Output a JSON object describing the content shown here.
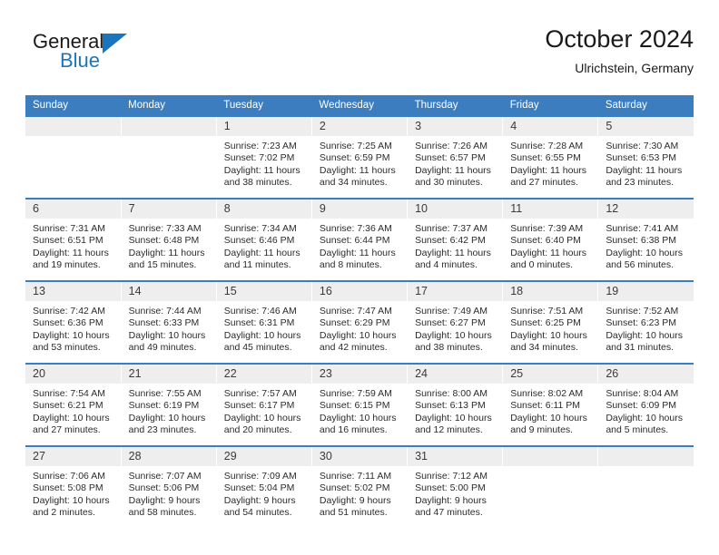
{
  "logo": {
    "word_one": "General",
    "word_two": "Blue",
    "mark": "triangle-mark",
    "color_dark": "#1a1a1a",
    "color_blue": "#1b75bc"
  },
  "header": {
    "title": "October 2024",
    "subtitle": "Ulrichstein, Germany"
  },
  "theme": {
    "header_blue": "#3c7dc0",
    "daynum_band": "#eeeeee",
    "text": "#2b2b2b"
  },
  "weekdays": [
    "Sunday",
    "Monday",
    "Tuesday",
    "Wednesday",
    "Thursday",
    "Friday",
    "Saturday"
  ],
  "labels": {
    "sunrise_prefix": "Sunrise: ",
    "sunset_prefix": "Sunset: ",
    "daylight_prefix": "Daylight: "
  },
  "weeks": [
    [
      {
        "blank": true,
        "day": "",
        "sunrise": "",
        "sunset": "",
        "daylight_line1": "",
        "daylight_line2": ""
      },
      {
        "blank": true,
        "day": "",
        "sunrise": "",
        "sunset": "",
        "daylight_line1": "",
        "daylight_line2": ""
      },
      {
        "blank": false,
        "day": "1",
        "sunrise": "Sunrise: 7:23 AM",
        "sunset": "Sunset: 7:02 PM",
        "daylight_line1": "Daylight: 11 hours",
        "daylight_line2": "and 38 minutes."
      },
      {
        "blank": false,
        "day": "2",
        "sunrise": "Sunrise: 7:25 AM",
        "sunset": "Sunset: 6:59 PM",
        "daylight_line1": "Daylight: 11 hours",
        "daylight_line2": "and 34 minutes."
      },
      {
        "blank": false,
        "day": "3",
        "sunrise": "Sunrise: 7:26 AM",
        "sunset": "Sunset: 6:57 PM",
        "daylight_line1": "Daylight: 11 hours",
        "daylight_line2": "and 30 minutes."
      },
      {
        "blank": false,
        "day": "4",
        "sunrise": "Sunrise: 7:28 AM",
        "sunset": "Sunset: 6:55 PM",
        "daylight_line1": "Daylight: 11 hours",
        "daylight_line2": "and 27 minutes."
      },
      {
        "blank": false,
        "day": "5",
        "sunrise": "Sunrise: 7:30 AM",
        "sunset": "Sunset: 6:53 PM",
        "daylight_line1": "Daylight: 11 hours",
        "daylight_line2": "and 23 minutes."
      }
    ],
    [
      {
        "blank": false,
        "day": "6",
        "sunrise": "Sunrise: 7:31 AM",
        "sunset": "Sunset: 6:51 PM",
        "daylight_line1": "Daylight: 11 hours",
        "daylight_line2": "and 19 minutes."
      },
      {
        "blank": false,
        "day": "7",
        "sunrise": "Sunrise: 7:33 AM",
        "sunset": "Sunset: 6:48 PM",
        "daylight_line1": "Daylight: 11 hours",
        "daylight_line2": "and 15 minutes."
      },
      {
        "blank": false,
        "day": "8",
        "sunrise": "Sunrise: 7:34 AM",
        "sunset": "Sunset: 6:46 PM",
        "daylight_line1": "Daylight: 11 hours",
        "daylight_line2": "and 11 minutes."
      },
      {
        "blank": false,
        "day": "9",
        "sunrise": "Sunrise: 7:36 AM",
        "sunset": "Sunset: 6:44 PM",
        "daylight_line1": "Daylight: 11 hours",
        "daylight_line2": "and 8 minutes."
      },
      {
        "blank": false,
        "day": "10",
        "sunrise": "Sunrise: 7:37 AM",
        "sunset": "Sunset: 6:42 PM",
        "daylight_line1": "Daylight: 11 hours",
        "daylight_line2": "and 4 minutes."
      },
      {
        "blank": false,
        "day": "11",
        "sunrise": "Sunrise: 7:39 AM",
        "sunset": "Sunset: 6:40 PM",
        "daylight_line1": "Daylight: 11 hours",
        "daylight_line2": "and 0 minutes."
      },
      {
        "blank": false,
        "day": "12",
        "sunrise": "Sunrise: 7:41 AM",
        "sunset": "Sunset: 6:38 PM",
        "daylight_line1": "Daylight: 10 hours",
        "daylight_line2": "and 56 minutes."
      }
    ],
    [
      {
        "blank": false,
        "day": "13",
        "sunrise": "Sunrise: 7:42 AM",
        "sunset": "Sunset: 6:36 PM",
        "daylight_line1": "Daylight: 10 hours",
        "daylight_line2": "and 53 minutes."
      },
      {
        "blank": false,
        "day": "14",
        "sunrise": "Sunrise: 7:44 AM",
        "sunset": "Sunset: 6:33 PM",
        "daylight_line1": "Daylight: 10 hours",
        "daylight_line2": "and 49 minutes."
      },
      {
        "blank": false,
        "day": "15",
        "sunrise": "Sunrise: 7:46 AM",
        "sunset": "Sunset: 6:31 PM",
        "daylight_line1": "Daylight: 10 hours",
        "daylight_line2": "and 45 minutes."
      },
      {
        "blank": false,
        "day": "16",
        "sunrise": "Sunrise: 7:47 AM",
        "sunset": "Sunset: 6:29 PM",
        "daylight_line1": "Daylight: 10 hours",
        "daylight_line2": "and 42 minutes."
      },
      {
        "blank": false,
        "day": "17",
        "sunrise": "Sunrise: 7:49 AM",
        "sunset": "Sunset: 6:27 PM",
        "daylight_line1": "Daylight: 10 hours",
        "daylight_line2": "and 38 minutes."
      },
      {
        "blank": false,
        "day": "18",
        "sunrise": "Sunrise: 7:51 AM",
        "sunset": "Sunset: 6:25 PM",
        "daylight_line1": "Daylight: 10 hours",
        "daylight_line2": "and 34 minutes."
      },
      {
        "blank": false,
        "day": "19",
        "sunrise": "Sunrise: 7:52 AM",
        "sunset": "Sunset: 6:23 PM",
        "daylight_line1": "Daylight: 10 hours",
        "daylight_line2": "and 31 minutes."
      }
    ],
    [
      {
        "blank": false,
        "day": "20",
        "sunrise": "Sunrise: 7:54 AM",
        "sunset": "Sunset: 6:21 PM",
        "daylight_line1": "Daylight: 10 hours",
        "daylight_line2": "and 27 minutes."
      },
      {
        "blank": false,
        "day": "21",
        "sunrise": "Sunrise: 7:55 AM",
        "sunset": "Sunset: 6:19 PM",
        "daylight_line1": "Daylight: 10 hours",
        "daylight_line2": "and 23 minutes."
      },
      {
        "blank": false,
        "day": "22",
        "sunrise": "Sunrise: 7:57 AM",
        "sunset": "Sunset: 6:17 PM",
        "daylight_line1": "Daylight: 10 hours",
        "daylight_line2": "and 20 minutes."
      },
      {
        "blank": false,
        "day": "23",
        "sunrise": "Sunrise: 7:59 AM",
        "sunset": "Sunset: 6:15 PM",
        "daylight_line1": "Daylight: 10 hours",
        "daylight_line2": "and 16 minutes."
      },
      {
        "blank": false,
        "day": "24",
        "sunrise": "Sunrise: 8:00 AM",
        "sunset": "Sunset: 6:13 PM",
        "daylight_line1": "Daylight: 10 hours",
        "daylight_line2": "and 12 minutes."
      },
      {
        "blank": false,
        "day": "25",
        "sunrise": "Sunrise: 8:02 AM",
        "sunset": "Sunset: 6:11 PM",
        "daylight_line1": "Daylight: 10 hours",
        "daylight_line2": "and 9 minutes."
      },
      {
        "blank": false,
        "day": "26",
        "sunrise": "Sunrise: 8:04 AM",
        "sunset": "Sunset: 6:09 PM",
        "daylight_line1": "Daylight: 10 hours",
        "daylight_line2": "and 5 minutes."
      }
    ],
    [
      {
        "blank": false,
        "day": "27",
        "sunrise": "Sunrise: 7:06 AM",
        "sunset": "Sunset: 5:08 PM",
        "daylight_line1": "Daylight: 10 hours",
        "daylight_line2": "and 2 minutes."
      },
      {
        "blank": false,
        "day": "28",
        "sunrise": "Sunrise: 7:07 AM",
        "sunset": "Sunset: 5:06 PM",
        "daylight_line1": "Daylight: 9 hours",
        "daylight_line2": "and 58 minutes."
      },
      {
        "blank": false,
        "day": "29",
        "sunrise": "Sunrise: 7:09 AM",
        "sunset": "Sunset: 5:04 PM",
        "daylight_line1": "Daylight: 9 hours",
        "daylight_line2": "and 54 minutes."
      },
      {
        "blank": false,
        "day": "30",
        "sunrise": "Sunrise: 7:11 AM",
        "sunset": "Sunset: 5:02 PM",
        "daylight_line1": "Daylight: 9 hours",
        "daylight_line2": "and 51 minutes."
      },
      {
        "blank": false,
        "day": "31",
        "sunrise": "Sunrise: 7:12 AM",
        "sunset": "Sunset: 5:00 PM",
        "daylight_line1": "Daylight: 9 hours",
        "daylight_line2": "and 47 minutes."
      },
      {
        "blank": true,
        "day": "",
        "sunrise": "",
        "sunset": "",
        "daylight_line1": "",
        "daylight_line2": ""
      },
      {
        "blank": true,
        "day": "",
        "sunrise": "",
        "sunset": "",
        "daylight_line1": "",
        "daylight_line2": ""
      }
    ]
  ]
}
